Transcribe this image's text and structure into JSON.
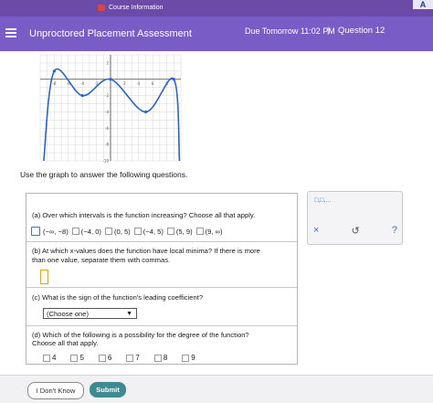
{
  "system_bar": {
    "label": "Course Information",
    "corner": "A"
  },
  "header": {
    "title": "Unproctored Placement Assessment",
    "due": "Due Tomorrow 11:02 PM",
    "separator": "|",
    "question": "Question 12"
  },
  "chart_data": {
    "type": "line",
    "xlim": [
      -10,
      10
    ],
    "ylim": [
      -10,
      3
    ],
    "grid": true,
    "x_tick_labels": [
      "-8",
      "-6",
      "-4",
      "-2",
      "2",
      "4",
      "6",
      "8"
    ],
    "y_tick_labels": [
      "2",
      "-2",
      "-4",
      "-6",
      "-8",
      "-10"
    ],
    "key_points": [
      {
        "x": -8,
        "y": 1
      },
      {
        "x": -4,
        "y": -2
      },
      {
        "x": 0,
        "y": 0
      },
      {
        "x": 5,
        "y": -4
      },
      {
        "x": 9,
        "y": 0
      }
    ],
    "asymptotes_left_x": -9.5,
    "asymptotes_right_x": 9.8
  },
  "instruction": "Use the graph to answer the following questions.",
  "part_a": {
    "question": "(a) Over which intervals is the function increasing? Choose all that apply.",
    "options": [
      "(−∞, −8)",
      "(−4, 0)",
      "(0, 5)",
      "(−4, 5)",
      "(5, 9)",
      "(9, ∞)"
    ]
  },
  "part_b": {
    "question_line1": "(b) At which x-values does the function have local minima? If there is more",
    "question_line2": "than one value, separate them with commas."
  },
  "part_c": {
    "question": "(c) What is the sign of the function's leading coefficient?",
    "select_value": "(Choose one)"
  },
  "part_d": {
    "question_line1": "(d) Which of the following is a possibility for the degree of the function?",
    "question_line2": "Choose all that apply.",
    "options": [
      "4",
      "5",
      "6",
      "7",
      "8",
      "9"
    ]
  },
  "tools": {
    "palette": "□,□,...",
    "clear": "×",
    "undo": "↺",
    "help": "?"
  },
  "footer": {
    "dont_know": "I Don't Know",
    "submit": "Submit"
  }
}
